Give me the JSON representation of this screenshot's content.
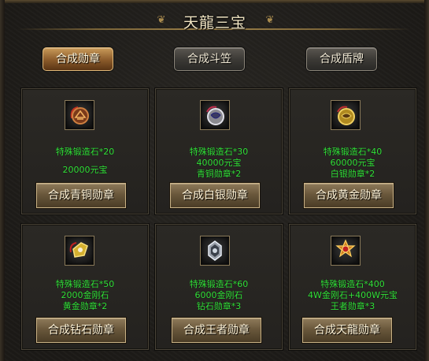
{
  "title": "天龍三宝",
  "tabs": [
    {
      "label": "合成勋章",
      "active": true
    },
    {
      "label": "合成斗笠",
      "active": false
    },
    {
      "label": "合成盾牌",
      "active": false
    }
  ],
  "cards": [
    {
      "icon": "bronze-medal-icon",
      "lines": [
        "特殊锻造石*20",
        "",
        "20000元宝"
      ],
      "button": "合成青铜勋章"
    },
    {
      "icon": "silver-medal-icon",
      "lines": [
        "特殊锻造石*30",
        "40000元宝",
        "青铜勋章*2"
      ],
      "button": "合成白银勋章"
    },
    {
      "icon": "gold-medal-icon",
      "lines": [
        "特殊锻造石*40",
        "60000元宝",
        "白银勋章*2"
      ],
      "button": "合成黄金勋章"
    },
    {
      "icon": "diamond-medal-icon",
      "lines": [
        "特殊锻造石*50",
        "2000金刚石",
        "黄金勋章*2"
      ],
      "button": "合成钻石勋章"
    },
    {
      "icon": "king-medal-icon",
      "lines": [
        "特殊锻造石*60",
        "6000金刚石",
        "钻石勋章*3"
      ],
      "button": "合成王者勋章"
    },
    {
      "icon": "tianlong-medal-icon",
      "lines": [
        "特殊锻造石*400",
        "4W金刚石+400W元宝",
        "王者勋章*3"
      ],
      "button": "合成天龍勋章"
    }
  ],
  "colors": {
    "requirement_text": "#33e13a",
    "title": "#f2e6c4",
    "accent": "#c99a58"
  }
}
